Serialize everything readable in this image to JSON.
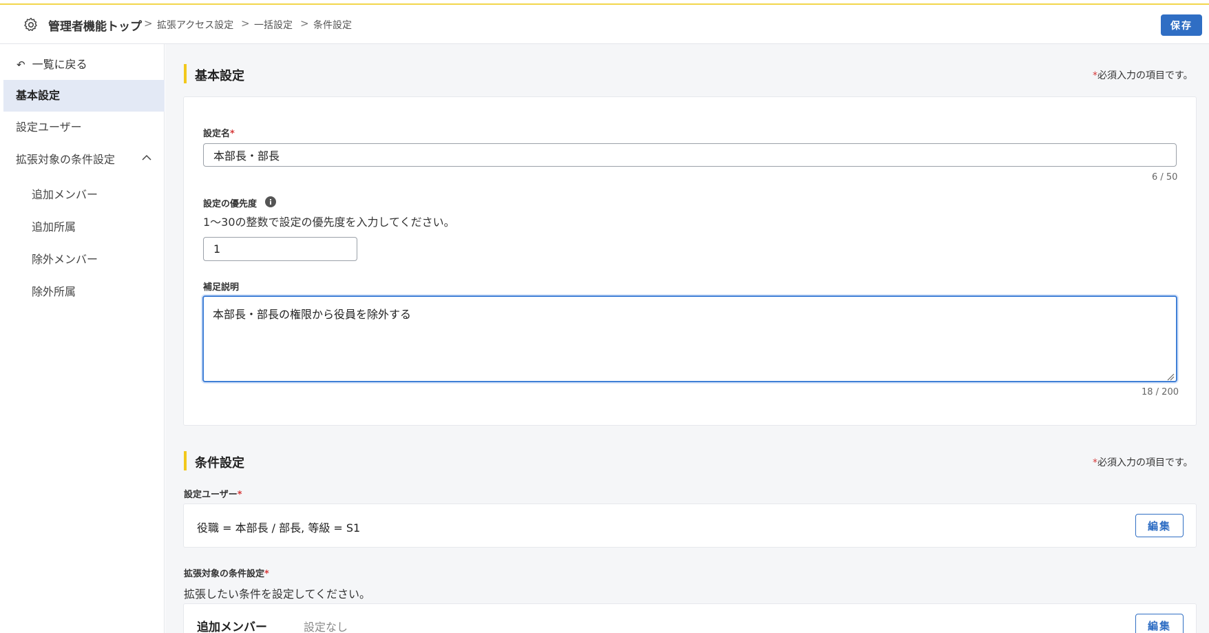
{
  "header": {
    "breadcrumb": [
      "管理者機能トップ",
      "拡張アクセス設定",
      "一括設定",
      "条件設定"
    ],
    "save_label": "保存",
    "separator": ">"
  },
  "sidebar": {
    "back_label": "一覧に戻る",
    "items": [
      {
        "label": "基本設定",
        "active": true
      },
      {
        "label": "設定ユーザー"
      },
      {
        "label": "拡張対象の条件設定"
      }
    ],
    "subitems": [
      "追加メンバー",
      "追加所属",
      "除外メンバー",
      "除外所属"
    ]
  },
  "basic": {
    "title": "基本設定",
    "required_note": "必須入力の項目です。",
    "name_label": "設定名",
    "name_value": "本部長・部長",
    "name_counter": "6 / 50",
    "priority_label": "設定の優先度",
    "priority_desc": "1〜30の整数で設定の優先度を入力してください。",
    "priority_value": "1",
    "note_label": "補足説明",
    "note_value": "本部長・部長の権限から役員を除外する",
    "note_counter": "18 / 200"
  },
  "conditions": {
    "title": "条件設定",
    "required_note": "必須入力の項目です。",
    "users_label": "設定ユーザー",
    "users_value": "役職 = 本部長 / 部長, 等級 = S1",
    "edit_label": "編集",
    "target_label": "拡張対象の条件設定",
    "target_desc": "拡張したい条件を設定してください。",
    "add_member_label": "追加メンバー",
    "add_member_value": "設定なし"
  },
  "colors": {
    "accent": "#2f6ec4",
    "section_bar": "#f2c81c",
    "required": "#d63a3a"
  }
}
